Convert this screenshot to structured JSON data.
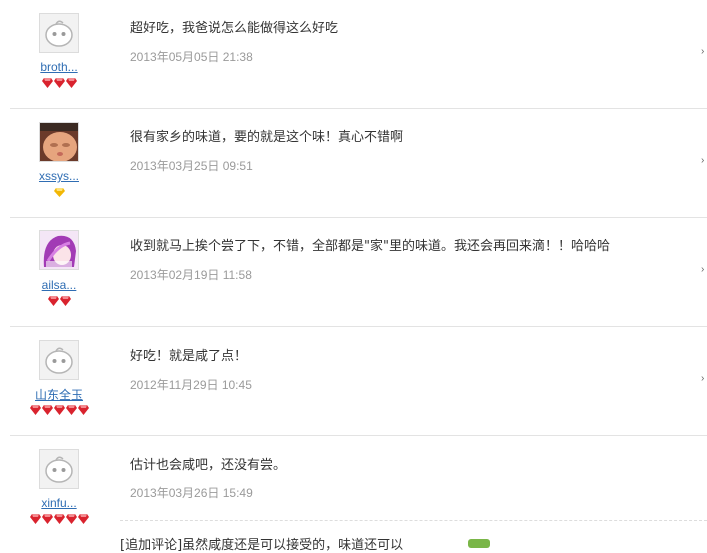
{
  "reviews": [
    {
      "username": "broth...",
      "avatar": "default-face-icon",
      "badge_type": "red-gem",
      "badge_count": 3,
      "content": "超好吃，我爸说怎么能做得这么好吃",
      "date": "2013年05月05日 21:38"
    },
    {
      "username": "xssys...",
      "avatar": "baby-photo",
      "badge_type": "yellow-diamond",
      "badge_count": 1,
      "content": "很有家乡的味道，要的就是这个味！真心不错啊",
      "date": "2013年03月25日 09:51"
    },
    {
      "username": "ailsa...",
      "avatar": "purple-hair-avatar",
      "badge_type": "red-gem",
      "badge_count": 2,
      "content": "收到就马上挨个尝了下，不错，全部都是\"家\"里的味道。我还会再回来滴！！哈哈哈",
      "date": "2013年02月19日 11:58"
    },
    {
      "username": "山东全玉",
      "avatar": "default-face-icon",
      "badge_type": "red-gem",
      "badge_count": 5,
      "content": "好吃！就是咸了点！",
      "date": "2012年11月29日 10:45"
    },
    {
      "username": "xinfu...",
      "avatar": "default-face-icon",
      "badge_type": "red-gem",
      "badge_count": 5,
      "content": "估计也会咸吧，还没有尝。",
      "date": "2013年03月26日 15:49"
    }
  ],
  "followup": {
    "text": "[追加评论]虽然咸度还是可以接受的，味道还可以"
  },
  "colors": {
    "username": "#2f6db3",
    "date": "#9a9a9a",
    "content": "#333333",
    "separator": "#e3e3e3",
    "gem_red": "#d9232e",
    "diamond_yellow": "#f2b705"
  }
}
